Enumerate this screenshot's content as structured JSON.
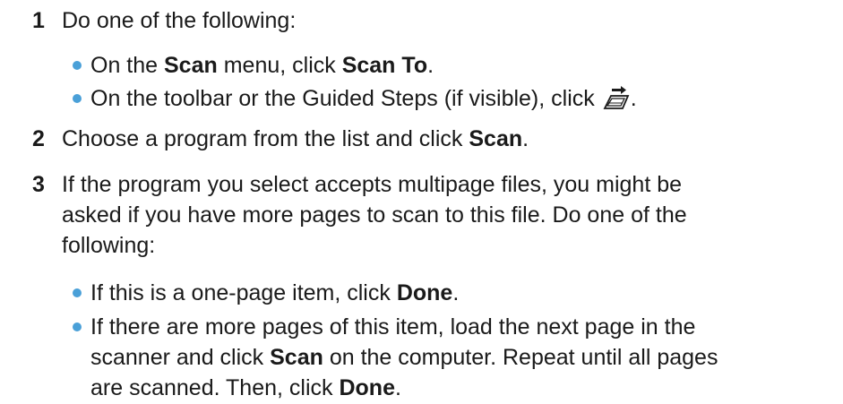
{
  "steps": [
    {
      "number": "1",
      "text": "Do one of the following:",
      "bullets": [
        {
          "pre": "On the ",
          "bold1": "Scan",
          "mid": " menu, click ",
          "bold2": "Scan To",
          "post": "."
        },
        {
          "pre": "On the toolbar or the Guided Steps (if visible), click",
          "icon": "scan-to-icon",
          "post": "."
        }
      ]
    },
    {
      "number": "2",
      "pre": "Choose a program from the list and click ",
      "bold": "Scan",
      "post": "."
    },
    {
      "number": "3",
      "lines": [
        "If the program you select accepts multipage files, you might be",
        "asked if you have more pages to scan to this file. Do one of the",
        "following:"
      ],
      "bullets": [
        {
          "pre": "If this is a one-page item, click ",
          "bold": "Done",
          "post": "."
        },
        {
          "line1": "If there are more pages of this item, load the next page in the",
          "line2_pre": "scanner and click ",
          "line2_bold": "Scan",
          "line2_post": " on the computer. Repeat until all pages",
          "line3_pre": "are scanned. Then, click ",
          "line3_bold": "Done",
          "line3_post": "."
        }
      ]
    }
  ],
  "colors": {
    "bullet": "#4aa0d8",
    "text": "#1a1a1a"
  }
}
